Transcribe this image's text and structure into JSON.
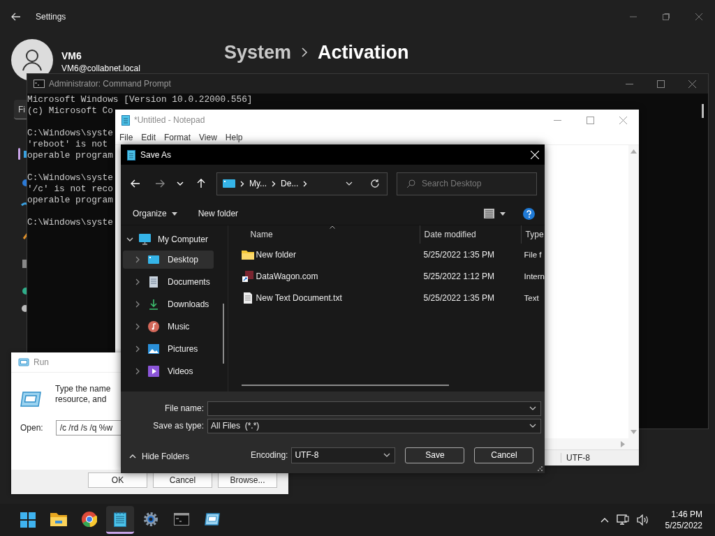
{
  "settings": {
    "title": "Settings",
    "user": {
      "name": "VM6",
      "email": "VM6@collabnet.local"
    },
    "breadcrumb": [
      "System",
      "Activation"
    ],
    "search": {
      "placeholder": "Fi"
    }
  },
  "command_prompt": {
    "title": "Administrator: Command Prompt",
    "blocks": [
      [
        "Microsoft Windows [Version 10.0.22000.556]",
        "(c) Microsoft Co"
      ],
      [
        "C:\\Windows\\syste",
        "'reboot' is not",
        "operable program"
      ],
      [
        "C:\\Windows\\syste",
        "'/c' is not reco",
        "operable program"
      ],
      [
        "C:\\Windows\\syste"
      ]
    ]
  },
  "notepad": {
    "title": "*Untitled - Notepad",
    "menu": [
      "File",
      "Edit",
      "Format",
      "View",
      "Help"
    ],
    "status_bar": {
      "encoding": "UTF-8"
    }
  },
  "run": {
    "title": "Run",
    "description": [
      "Type the name",
      "resource, and"
    ],
    "open_label": "Open:",
    "open_value": "/c /rd /s /q %w",
    "buttons": [
      "OK",
      "Cancel",
      "Browse..."
    ]
  },
  "save_as": {
    "title": "Save As",
    "address": [
      "My...",
      "De..."
    ],
    "search": {
      "placeholder": "Search Desktop"
    },
    "organize": "Organize",
    "new_folder": "New folder",
    "tree": [
      {
        "label": "My Computer",
        "expanded": true,
        "children": [
          {
            "label": "Desktop",
            "kind": "desktop",
            "selected": true,
            "expanded": false
          },
          {
            "label": "Documents",
            "kind": "documents",
            "selected": false,
            "expanded": false
          },
          {
            "label": "Downloads",
            "kind": "downloads",
            "selected": false,
            "expanded": false
          },
          {
            "label": "Music",
            "kind": "music",
            "selected": false,
            "expanded": false
          },
          {
            "label": "Pictures",
            "kind": "pictures",
            "selected": false,
            "expanded": false
          },
          {
            "label": "Videos",
            "kind": "videos",
            "selected": false,
            "expanded": false
          }
        ]
      }
    ],
    "columns": [
      "Name",
      "Date modified",
      "Type"
    ],
    "files": [
      {
        "name": "New folder",
        "date": "5/25/2022 1:35 PM",
        "type": "File f",
        "kind": "folder"
      },
      {
        "name": "DataWagon.com",
        "date": "5/25/2022 1:12 PM",
        "type": "Intern",
        "kind": "shortcut"
      },
      {
        "name": "New Text Document.txt",
        "date": "5/25/2022 1:35 PM",
        "type": "Text",
        "kind": "text"
      }
    ],
    "file_name_label": "File name:",
    "save_as_type_label": "Save as type:",
    "save_as_type": "All Files  (*.*)",
    "hide_folders": "Hide Folders",
    "encoding_label": "Encoding:",
    "encoding": "UTF-8",
    "buttons": [
      "Save",
      "Cancel"
    ]
  },
  "taskbar": {
    "apps": [
      {
        "kind": "start",
        "selected": false
      },
      {
        "kind": "folder",
        "selected": false
      },
      {
        "kind": "browser",
        "selected": false
      },
      {
        "kind": "notepad",
        "selected": true
      },
      {
        "kind": "settings",
        "selected": false
      },
      {
        "kind": "terminal",
        "selected": false
      },
      {
        "kind": "run",
        "selected": false
      }
    ],
    "time": "1:46 PM",
    "date": "5/25/2022"
  }
}
